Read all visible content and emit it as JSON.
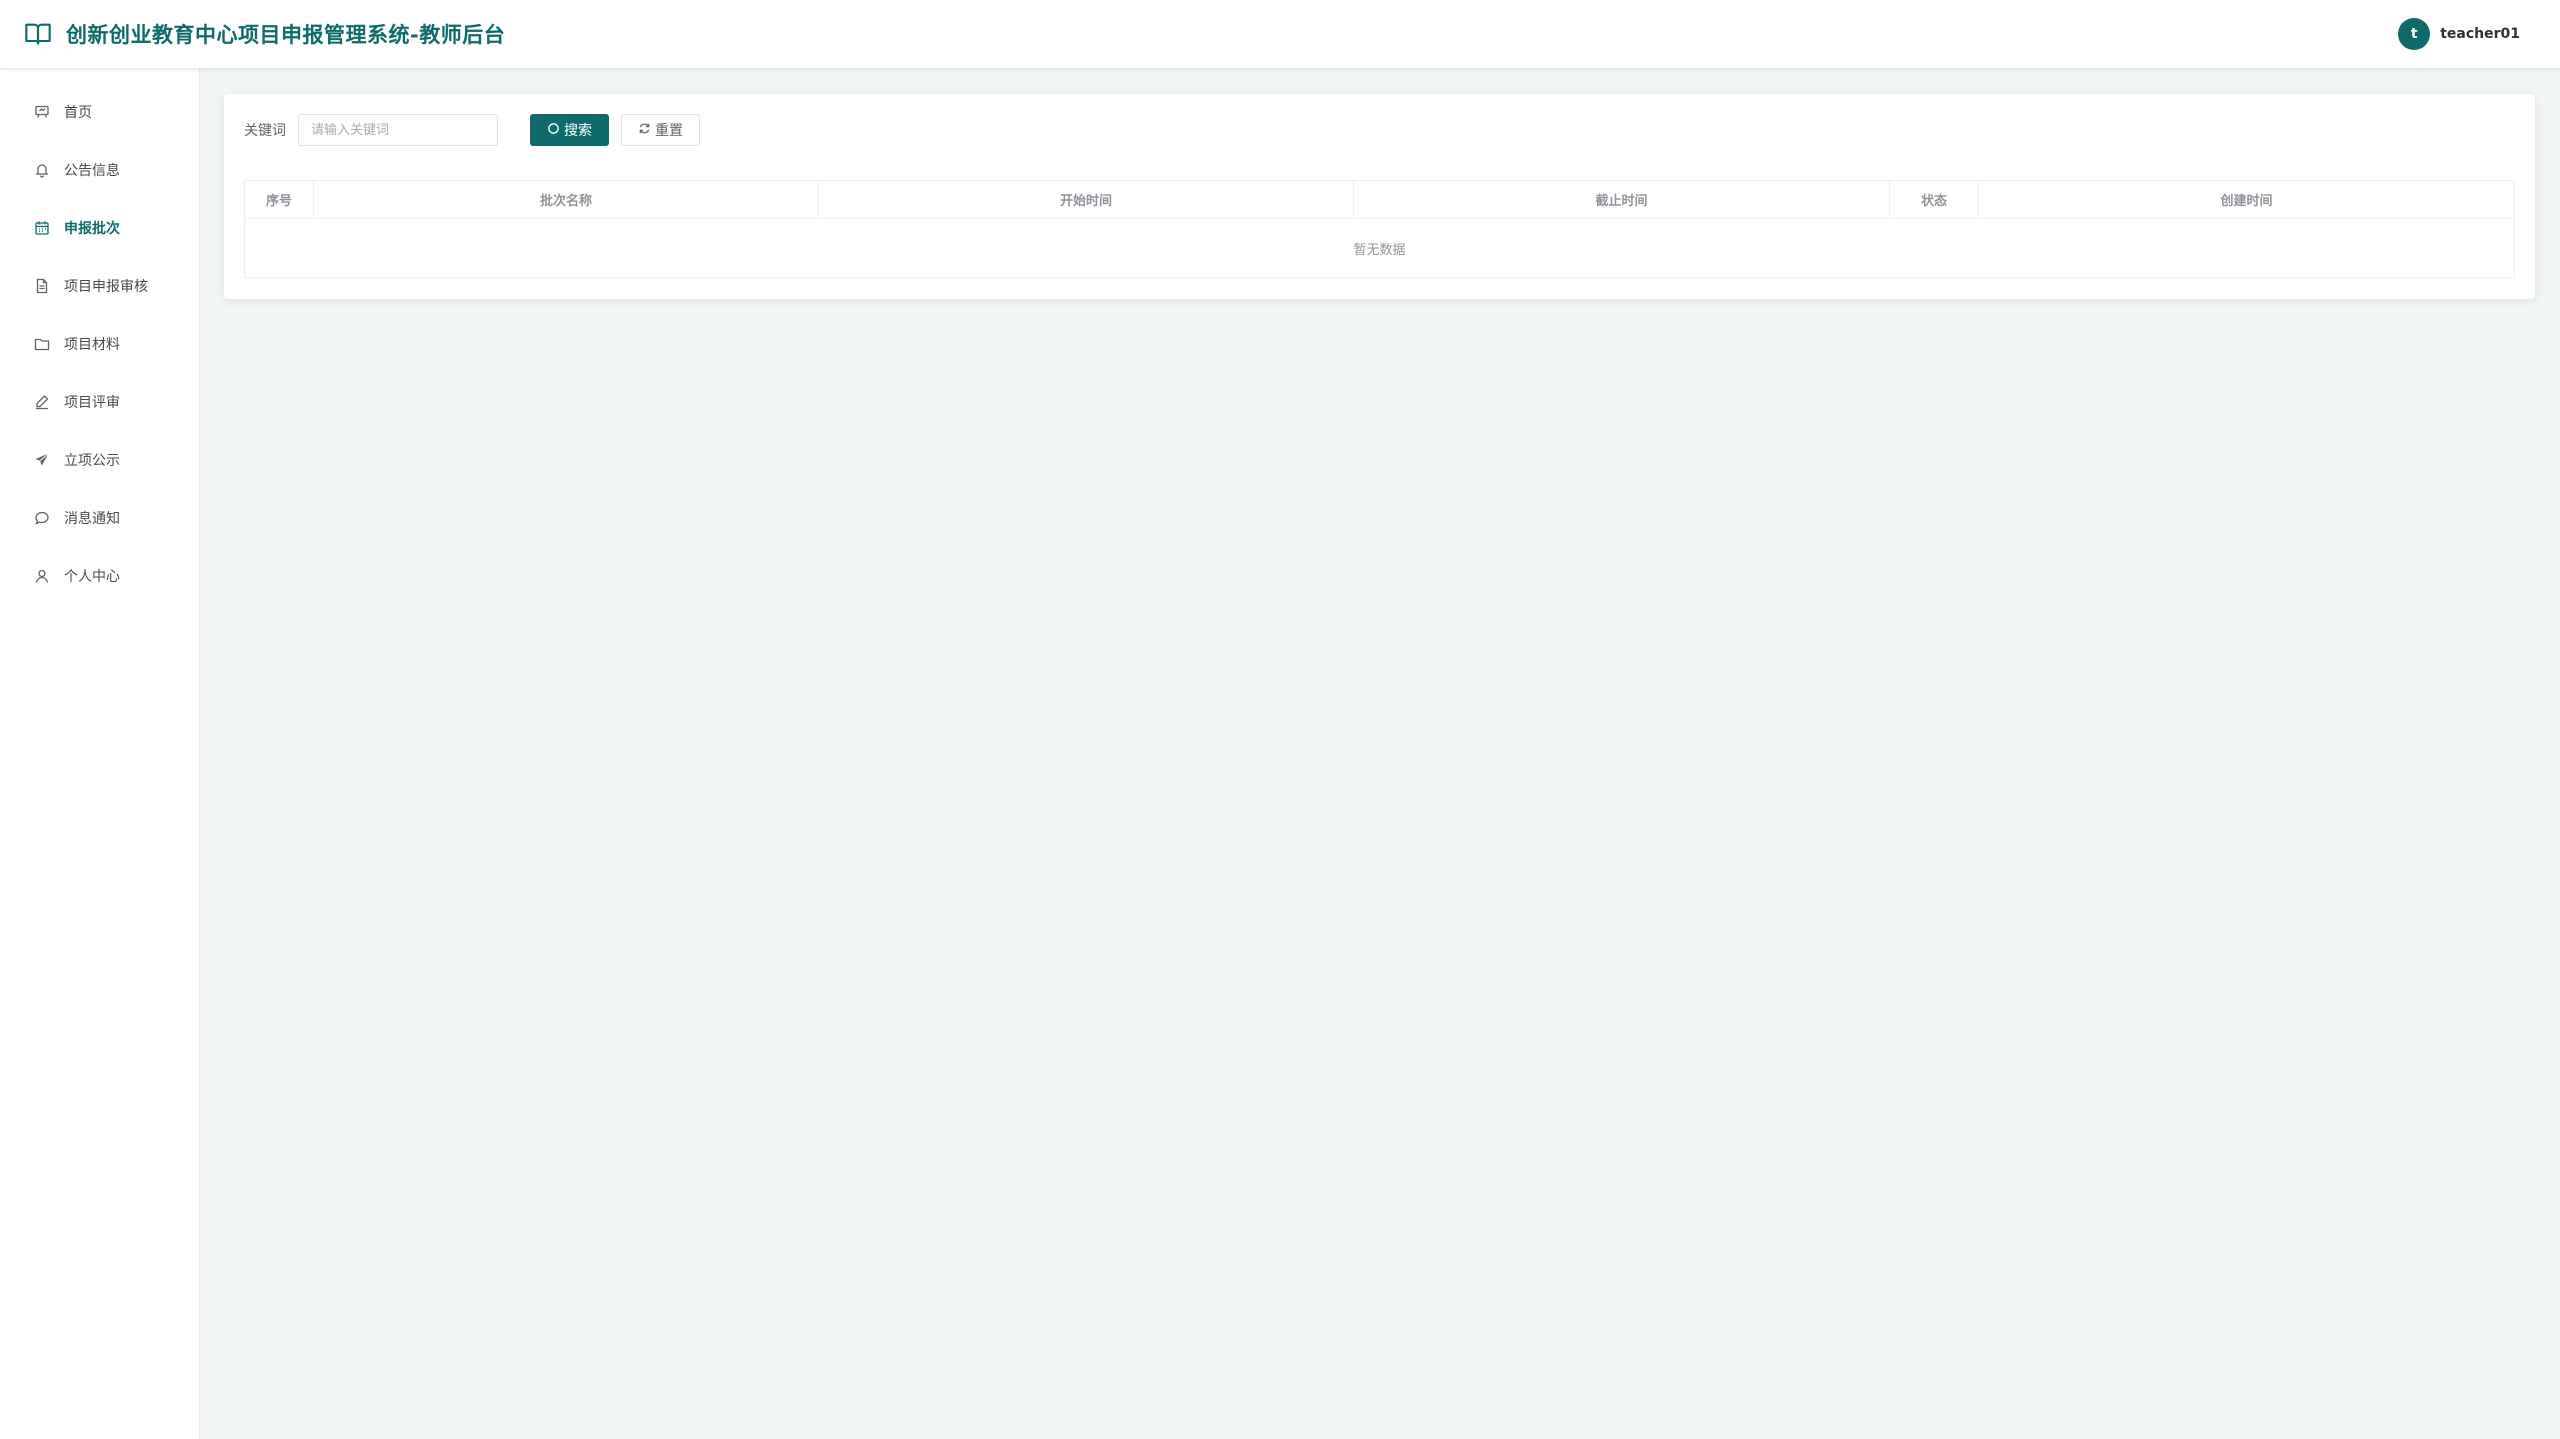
{
  "header": {
    "title": "创新创业教育中心项目申报管理系统-教师后台",
    "logo_icon": "book-open-icon",
    "user": {
      "avatar_letter": "t",
      "name": "teacher01"
    }
  },
  "sidebar": {
    "items": [
      {
        "label": "首页",
        "icon": "presentation-icon",
        "active": false
      },
      {
        "label": "公告信息",
        "icon": "bell-icon",
        "active": false
      },
      {
        "label": "申报批次",
        "icon": "calendar-icon",
        "active": true
      },
      {
        "label": "项目申报审核",
        "icon": "document-icon",
        "active": false
      },
      {
        "label": "项目材料",
        "icon": "folder-icon",
        "active": false
      },
      {
        "label": "项目评审",
        "icon": "edit-pen-icon",
        "active": false
      },
      {
        "label": "立项公示",
        "icon": "paper-plane-icon",
        "active": false
      },
      {
        "label": "消息通知",
        "icon": "chat-bubble-icon",
        "active": false
      },
      {
        "label": "个人中心",
        "icon": "user-icon",
        "active": false
      }
    ]
  },
  "search": {
    "label": "关键词",
    "placeholder": "请输入关键词",
    "search_button": "搜索",
    "reset_button": "重置"
  },
  "table": {
    "columns": [
      "序号",
      "批次名称",
      "开始时间",
      "截止时间",
      "状态",
      "创建时间"
    ],
    "empty_text": "暂无数据"
  },
  "colors": {
    "primary": "#0f6b6b",
    "background": "#f1f5f5"
  }
}
